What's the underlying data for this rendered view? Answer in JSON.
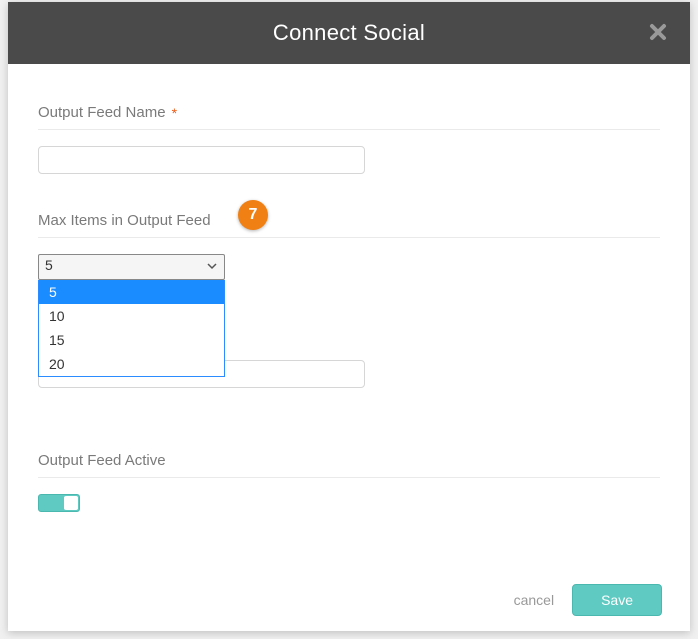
{
  "modal": {
    "title": "Connect Social"
  },
  "form": {
    "feed_name": {
      "label": "Output Feed Name",
      "required_mark": "*",
      "value": ""
    },
    "max_items": {
      "label": "Max Items in Output Feed",
      "selected": "5",
      "options": [
        "5",
        "10",
        "15",
        "20"
      ]
    },
    "hidden_field": {
      "value": ""
    },
    "active": {
      "label": "Output Feed Active",
      "value": true
    }
  },
  "annotation": {
    "number": "7"
  },
  "actions": {
    "cancel": "cancel",
    "save": "Save"
  }
}
